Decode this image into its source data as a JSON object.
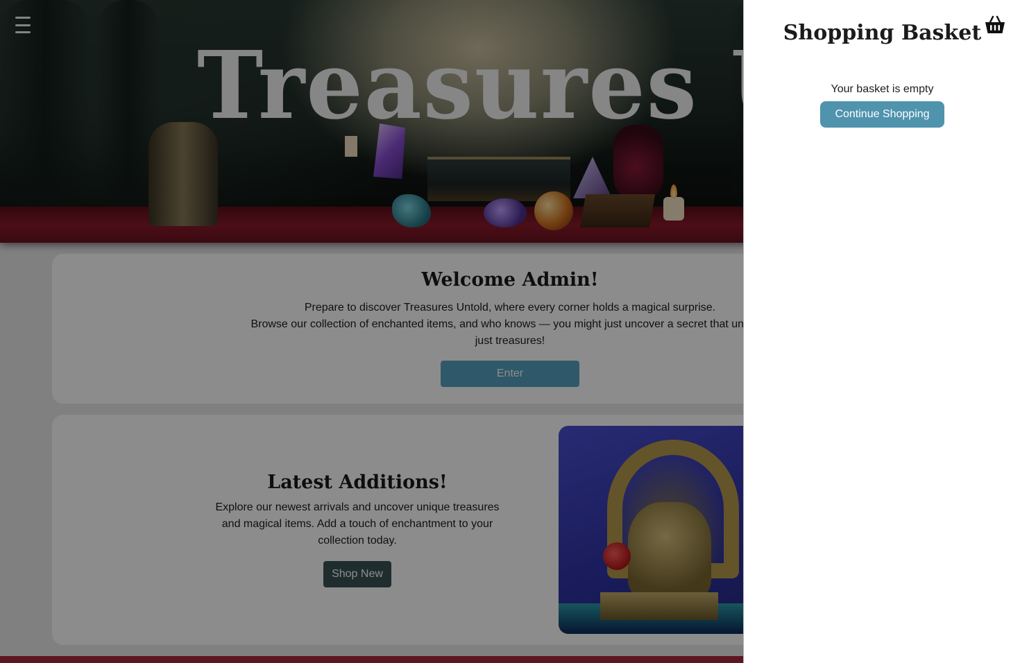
{
  "header": {
    "menu_icon": "hamburger-menu-icon",
    "hero_title": "Treasures Unto"
  },
  "welcome": {
    "title": "Welcome Admin!",
    "line1": "Prepare to discover Treasures Untold, where every corner holds a magical surprise.",
    "line2": "Browse our collection of enchanted items, and who knows — you might just uncover a secret that unlocks",
    "line3": "just treasures!",
    "enter_label": "Enter"
  },
  "latest": {
    "title": "Latest Additions!",
    "line1": "Explore our newest arrivals and uncover unique treasures",
    "line2": "and magical items. Add a touch of enchantment to your",
    "line3": "collection today.",
    "shop_new_label": "Shop New"
  },
  "basket": {
    "title": "Shopping Basket",
    "icon": "basket-icon",
    "empty_message": "Your basket is empty",
    "continue_label": "Continue Shopping"
  },
  "colors": {
    "enter_button": "#57a3c2",
    "shop_new_button": "#3a5254",
    "continue_button": "#4f93ad",
    "footer_strip": "#a8283c"
  }
}
